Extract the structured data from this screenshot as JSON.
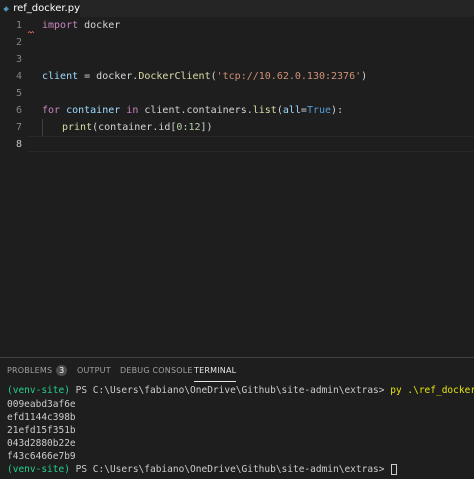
{
  "tab": {
    "label": "ref_docker.py"
  },
  "editor": {
    "line_numbers": [
      "1",
      "2",
      "3",
      "4",
      "5",
      "6",
      "7",
      "8"
    ],
    "lines": [
      {
        "kw": "import",
        "rest": " docker"
      },
      {},
      {},
      {
        "var": "client",
        "eq": " = docker.",
        "fn": "DockerClient",
        "open": "(",
        "str": "'tcp://10.62.0.130:2376'",
        "close": ")"
      },
      {},
      {
        "kw1": "for",
        "var1": " container ",
        "kw2": "in",
        "mid": " client.containers.",
        "fn": "list",
        "open": "(",
        "var2": "all",
        "eq": "=",
        "kw3": "True",
        "close": "):"
      },
      {
        "fn": "print",
        "open": "(container.id[",
        "num1": "0",
        "colon": ":",
        "num2": "12",
        "close": "])"
      },
      {}
    ]
  },
  "panel": {
    "tabs": [
      {
        "label": "PROBLEMS",
        "badge": "3"
      },
      {
        "label": "OUTPUT"
      },
      {
        "label": "DEBUG CONSOLE"
      },
      {
        "label": "TERMINAL"
      }
    ],
    "terminal": {
      "prompt_env": "(venv-site)",
      "prompt_path": " PS C:\\Users\\fabiano\\OneDrive\\Github\\site-admin\\extras> ",
      "command": "py .\\ref_docker.py",
      "output": [
        "009eabd3af6e",
        "efd1144c398b",
        "21efd15f351b",
        "043d2880b22e",
        "f43c6466e7b9"
      ]
    }
  },
  "colors": {
    "background": "#1e1e1e",
    "keyword": "#c586c0",
    "string": "#ce9178",
    "venv": "#23d18b",
    "command": "#e5e510",
    "python_icon": "#519aba"
  }
}
